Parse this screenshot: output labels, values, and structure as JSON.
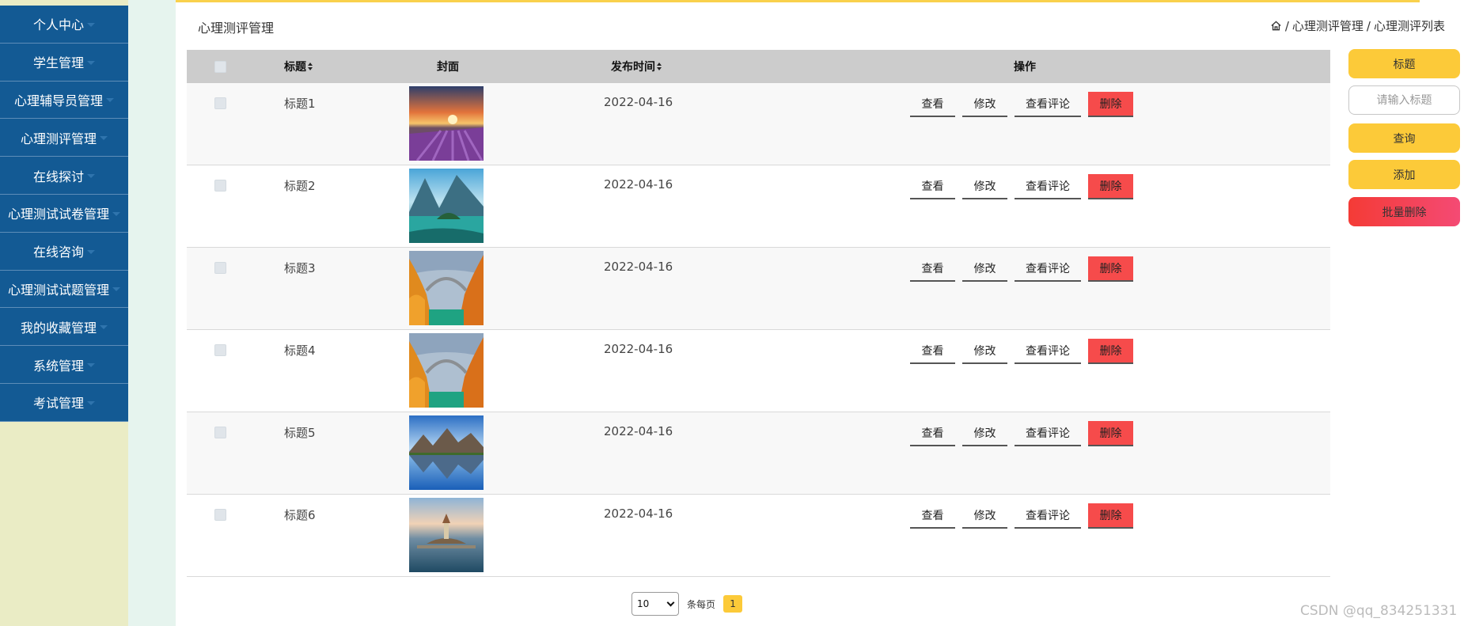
{
  "sidebar": {
    "items": [
      {
        "label": "个人中心"
      },
      {
        "label": "学生管理"
      },
      {
        "label": "心理辅导员管理"
      },
      {
        "label": "心理测评管理"
      },
      {
        "label": "在线探讨"
      },
      {
        "label": "心理测试试卷管理"
      },
      {
        "label": "在线咨询"
      },
      {
        "label": "心理测试试题管理"
      },
      {
        "label": "我的收藏管理"
      },
      {
        "label": "系统管理"
      },
      {
        "label": "考试管理"
      }
    ]
  },
  "header": {
    "title": "心理测评管理",
    "breadcrumb": [
      "心理测评管理",
      "心理测评列表"
    ],
    "separator": "/"
  },
  "table": {
    "columns": {
      "title": "标题",
      "cover": "封面",
      "publish_time": "发布时间",
      "actions": "操作"
    },
    "rows": [
      {
        "title": "标题1",
        "date": "2022-04-16",
        "cover": "lavender-field-sunset"
      },
      {
        "title": "标题2",
        "date": "2022-04-16",
        "cover": "mountain-lake-island"
      },
      {
        "title": "标题3",
        "date": "2022-04-16",
        "cover": "autumn-bridge-river"
      },
      {
        "title": "标题4",
        "date": "2022-04-16",
        "cover": "autumn-bridge-river"
      },
      {
        "title": "标题5",
        "date": "2022-04-16",
        "cover": "mountain-lake-reflection"
      },
      {
        "title": "标题6",
        "date": "2022-04-16",
        "cover": "castle-on-lake-island"
      }
    ],
    "row_actions": {
      "view": "查看",
      "edit": "修改",
      "view_comments": "查看评论",
      "delete": "删除"
    }
  },
  "search_panel": {
    "field_label": "标题",
    "input_placeholder": "请输入标题",
    "query_label": "查询",
    "add_label": "添加",
    "batch_delete_label": "批量删除"
  },
  "pagination": {
    "page_size": "10",
    "per_page_text": "条每页",
    "current_page": "1"
  },
  "watermark": "CSDN @qq_834251331",
  "colors": {
    "sidebar": "#135a94",
    "accent": "#fcca39",
    "danger": "#f64b4b"
  }
}
